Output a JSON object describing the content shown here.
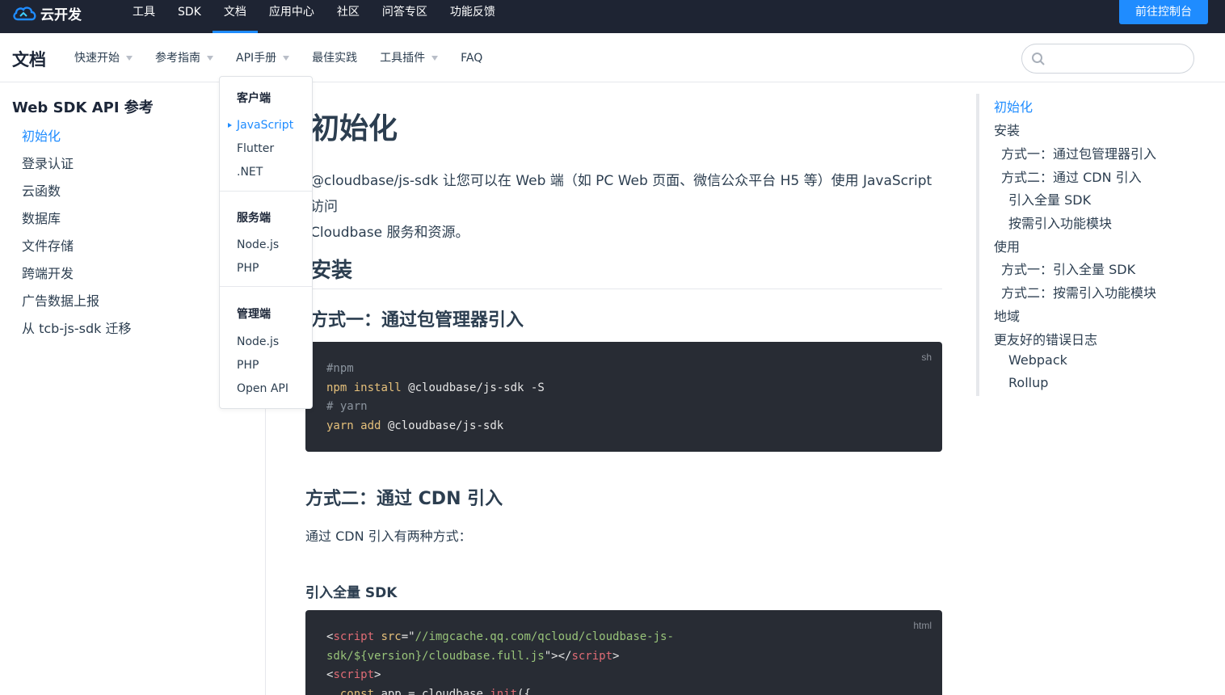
{
  "topbar": {
    "logo_text": "云开发",
    "nav": [
      "工具",
      "SDK",
      "文档",
      "应用中心",
      "社区",
      "问答专区",
      "功能反馈"
    ],
    "active_index": 2,
    "console_button": "前往控制台",
    "accent_color": "#1f8cff",
    "background_color": "#1e2433"
  },
  "subnav": {
    "title": "文档",
    "items": [
      {
        "label": "快速开始",
        "has_caret": true
      },
      {
        "label": "参考指南",
        "has_caret": true
      },
      {
        "label": "API手册",
        "has_caret": true
      },
      {
        "label": "最佳实践",
        "has_caret": false
      },
      {
        "label": "工具插件",
        "has_caret": true
      },
      {
        "label": "FAQ",
        "has_caret": false
      }
    ],
    "search_placeholder": ""
  },
  "sidebar": {
    "title": "Web SDK API 参考",
    "items": [
      "初始化",
      "登录认证",
      "云函数",
      "数据库",
      "文件存储",
      "跨端开发",
      "广告数据上报",
      "从 tcb-js-sdk 迁移"
    ],
    "active_index": 0
  },
  "dropdown": {
    "groups": [
      {
        "heading": "客户端",
        "items": [
          "JavaScript",
          "Flutter",
          ".NET"
        ]
      },
      {
        "heading": "服务端",
        "items": [
          "Node.js",
          "PHP"
        ]
      },
      {
        "heading": "管理端",
        "items": [
          "Node.js",
          "PHP",
          "Open API"
        ]
      }
    ],
    "active_item": "JavaScript"
  },
  "content": {
    "h1": "初始化",
    "intro_line1": "@cloudbase/js-sdk 让您可以在 Web 端（如 PC Web 页面、微信公众平台 H5 等）使用 JavaScript 访问",
    "intro_line2": "Cloudbase 服务和资源。",
    "h2_install": "安装",
    "h3_method1": "方式一：通过包管理器引入",
    "code1": {
      "lang": "sh",
      "l1": "#npm",
      "l2_cmd": "npm",
      "l2_kw": "install",
      "l2_rest": " @cloudbase/js-sdk -S",
      "l3": "# yarn",
      "l4_cmd": "yarn",
      "l4_kw": "add",
      "l4_rest": " @cloudbase/js-sdk"
    },
    "h3_method2": "方式二：通过 CDN 引入",
    "cdn_text": "通过 CDN 引入有两种方式：",
    "h4_full": "引入全量 SDK",
    "code2": {
      "lang": "html",
      "l1_open": "<",
      "l1_tag": "script",
      "l1_attr": " src",
      "l1_eq": "=\"",
      "l1_str": "//imgcache.qq.com/qcloud/cloudbase-js-",
      "l2_str": "sdk/${version}/cloudbase.full.js",
      "l2_close": "\"></",
      "l2_tag": "script",
      "l2_end": ">",
      "l3_open": "<",
      "l3_tag": "script",
      "l3_end": ">",
      "l4_indent": "  ",
      "l4_kw": "const",
      "l4_mid": " app = cloudbase.",
      "l4_fn": "init",
      "l4_end": "({"
    }
  },
  "toc": {
    "items": [
      {
        "label": "初始化",
        "level": 0
      },
      {
        "label": "安装",
        "level": 0
      },
      {
        "label": "方式一：通过包管理器引入",
        "level": 1
      },
      {
        "label": "方式二：通过 CDN 引入",
        "level": 1
      },
      {
        "label": "引入全量 SDK",
        "level": 2
      },
      {
        "label": "按需引入功能模块",
        "level": 2
      },
      {
        "label": "使用",
        "level": 0
      },
      {
        "label": "方式一：引入全量 SDK",
        "level": 1
      },
      {
        "label": "方式二：按需引入功能模块",
        "level": 1
      },
      {
        "label": "地域",
        "level": 0
      },
      {
        "label": "更友好的错误日志",
        "level": 0
      },
      {
        "label": "Webpack",
        "level": 2
      },
      {
        "label": "Rollup",
        "level": 2
      }
    ],
    "active_index": 0
  }
}
